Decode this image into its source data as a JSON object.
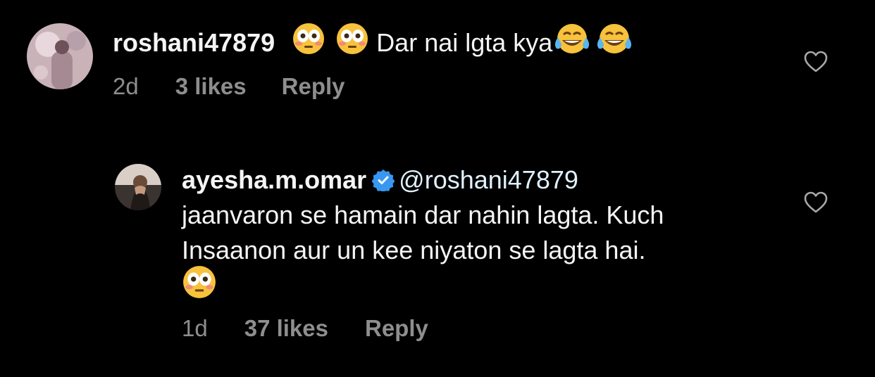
{
  "comments": [
    {
      "username": "roshani47879",
      "text": "Dar nai lgta kya",
      "age": "2d",
      "likes": "3 likes",
      "reply": "Reply",
      "leading_emojis": [
        "flushed-face",
        "flushed-face"
      ],
      "trailing_emojis": [
        "tears-of-joy-face",
        "tears-of-joy-face"
      ]
    },
    {
      "username": "ayesha.m.omar",
      "verified": true,
      "mention": "@roshani47879",
      "line1": "jaanvaron se hamain dar nahin lagta. Kuch",
      "line2": "Insaanon aur un kee niyaton se lagta hai.",
      "trailing_emojis": [
        "flushed-face"
      ],
      "age": "1d",
      "likes": "37 likes",
      "reply": "Reply"
    }
  ],
  "colors": {
    "background": "#000000",
    "text": "#f5f5f5",
    "meta": "#8e8e8e",
    "verified": "#3897f0"
  }
}
